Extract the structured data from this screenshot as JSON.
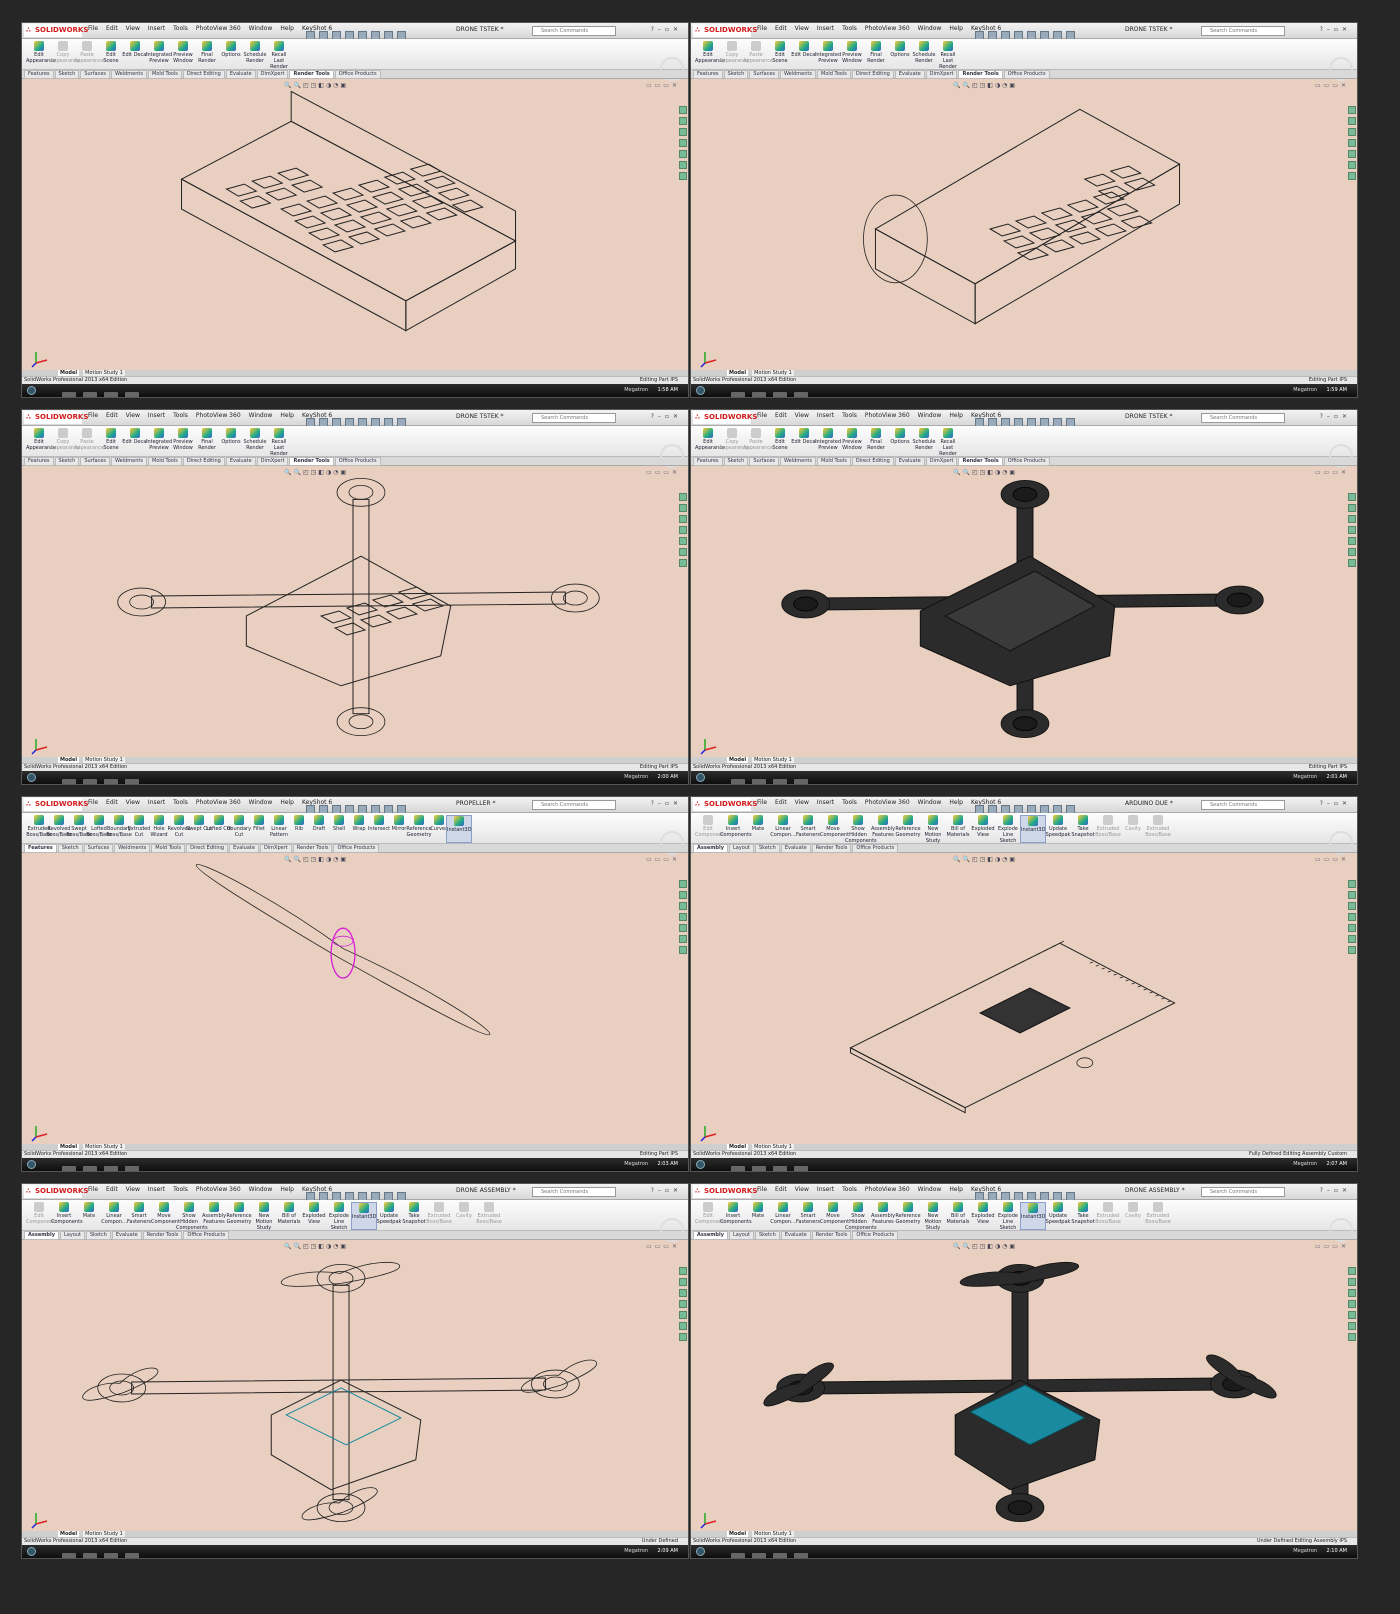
{
  "app": {
    "logo": "SOLIDWORKS",
    "menus": [
      "File",
      "Edit",
      "View",
      "Insert",
      "Tools",
      "PhotoView 360",
      "Window",
      "Help",
      "KeyShot 6"
    ],
    "search_placeholder": "Search Commands",
    "edition": "SolidWorks Professional 2013 x64 Edition",
    "taskbar_user": "Megatron"
  },
  "ribbons": {
    "render": [
      "Edit Appearance",
      "Copy Appearance",
      "Paste Appearance",
      "Edit Scene",
      "Edit Decal",
      "Integrated Preview",
      "Preview Window",
      "Final Render",
      "Options",
      "Schedule Render",
      "Recall Last Render"
    ],
    "features": [
      "Extruded Boss/Base",
      "Revolved Boss/Base",
      "Swept Boss/Base",
      "Lofted Boss/Base",
      "Boundary Boss/Base",
      "Extruded Cut",
      "Hole Wizard",
      "Revolved Cut",
      "Swept Cut",
      "Lofted Cut",
      "Boundary Cut",
      "Fillet",
      "Linear Pattern",
      "Rib",
      "Draft",
      "Shell",
      "Wrap",
      "Intersect",
      "Mirror",
      "Reference Geometry",
      "Curves",
      "Instant3D"
    ],
    "assembly": [
      "Edit Component",
      "Insert Components",
      "Mate",
      "Linear Compon...",
      "Smart Fasteners",
      "Move Component",
      "Show Hidden Components",
      "Assembly Features",
      "Reference Geometry",
      "New Motion Study",
      "Bill of Materials",
      "Exploded View",
      "Explode Line Sketch",
      "Instant3D",
      "Update Speedpak",
      "Take Snapshot",
      "Extruded Boss/Base",
      "Cavity",
      "Extruded Boss/Base"
    ]
  },
  "tabsets": {
    "part": [
      "Features",
      "Sketch",
      "Surfaces",
      "Weldments",
      "Mold Tools",
      "Direct Editing",
      "Evaluate",
      "DimXpert",
      "Render Tools",
      "Office Products"
    ],
    "assembly": [
      "Assembly",
      "Layout",
      "Sketch",
      "Evaluate",
      "Render Tools",
      "Office Products"
    ]
  },
  "bottom_tabs": [
    "Model",
    "Motion Study 1"
  ],
  "panels": [
    {
      "doc": "DRONE TSTEK *",
      "ribbon": "render",
      "tabs": "part",
      "active_tab": "Render Tools",
      "status": [
        "Editing Part",
        "IPS"
      ],
      "time": "1:58 AM",
      "scene": "tray_wire"
    },
    {
      "doc": "DRONE TSTEK *",
      "ribbon": "render",
      "tabs": "part",
      "active_tab": "Render Tools",
      "status": [
        "Editing Part",
        "IPS"
      ],
      "time": "1:59 AM",
      "scene": "body_wire"
    },
    {
      "doc": "DRONE TSTEK *",
      "ribbon": "render",
      "tabs": "part",
      "active_tab": "Render Tools",
      "status": [
        "Editing Part",
        "IPS"
      ],
      "time": "2:00 AM",
      "scene": "frame_wire"
    },
    {
      "doc": "DRONE TSTEK *",
      "ribbon": "render",
      "tabs": "part",
      "active_tab": "Render Tools",
      "status": [
        "Editing Part",
        "IPS"
      ],
      "time": "2:01 AM",
      "scene": "frame_solid"
    },
    {
      "doc": "PROPELLER *",
      "ribbon": "features",
      "tabs": "part",
      "active_tab": "Features",
      "status": [
        "Editing Part",
        "IPS"
      ],
      "time": "2:03 AM",
      "scene": "propeller"
    },
    {
      "doc": "ARDUINO DUE *",
      "ribbon": "assembly",
      "tabs": "assembly",
      "active_tab": "Assembly",
      "status": [
        "Fully Defined",
        "Editing Assembly",
        "Custom"
      ],
      "time": "2:07 AM",
      "scene": "arduino"
    },
    {
      "doc": "DRONE ASSEMBLY *",
      "ribbon": "assembly",
      "tabs": "assembly",
      "active_tab": "Assembly",
      "status": [
        "Under Defined"
      ],
      "time": "2:09 AM",
      "scene": "assembly_wire"
    },
    {
      "doc": "DRONE ASSEMBLY *",
      "ribbon": "assembly",
      "tabs": "assembly",
      "active_tab": "Assembly",
      "status": [
        "Under Defined",
        "Editing Assembly",
        "IPS"
      ],
      "time": "2:10 AM",
      "scene": "assembly_solid"
    }
  ],
  "colors": {
    "viewport": "#e8cfbf",
    "wire": "#222222",
    "solid": "#2b2b2b",
    "selection": "#d61ed6",
    "pcb": "#1a8aa0"
  }
}
